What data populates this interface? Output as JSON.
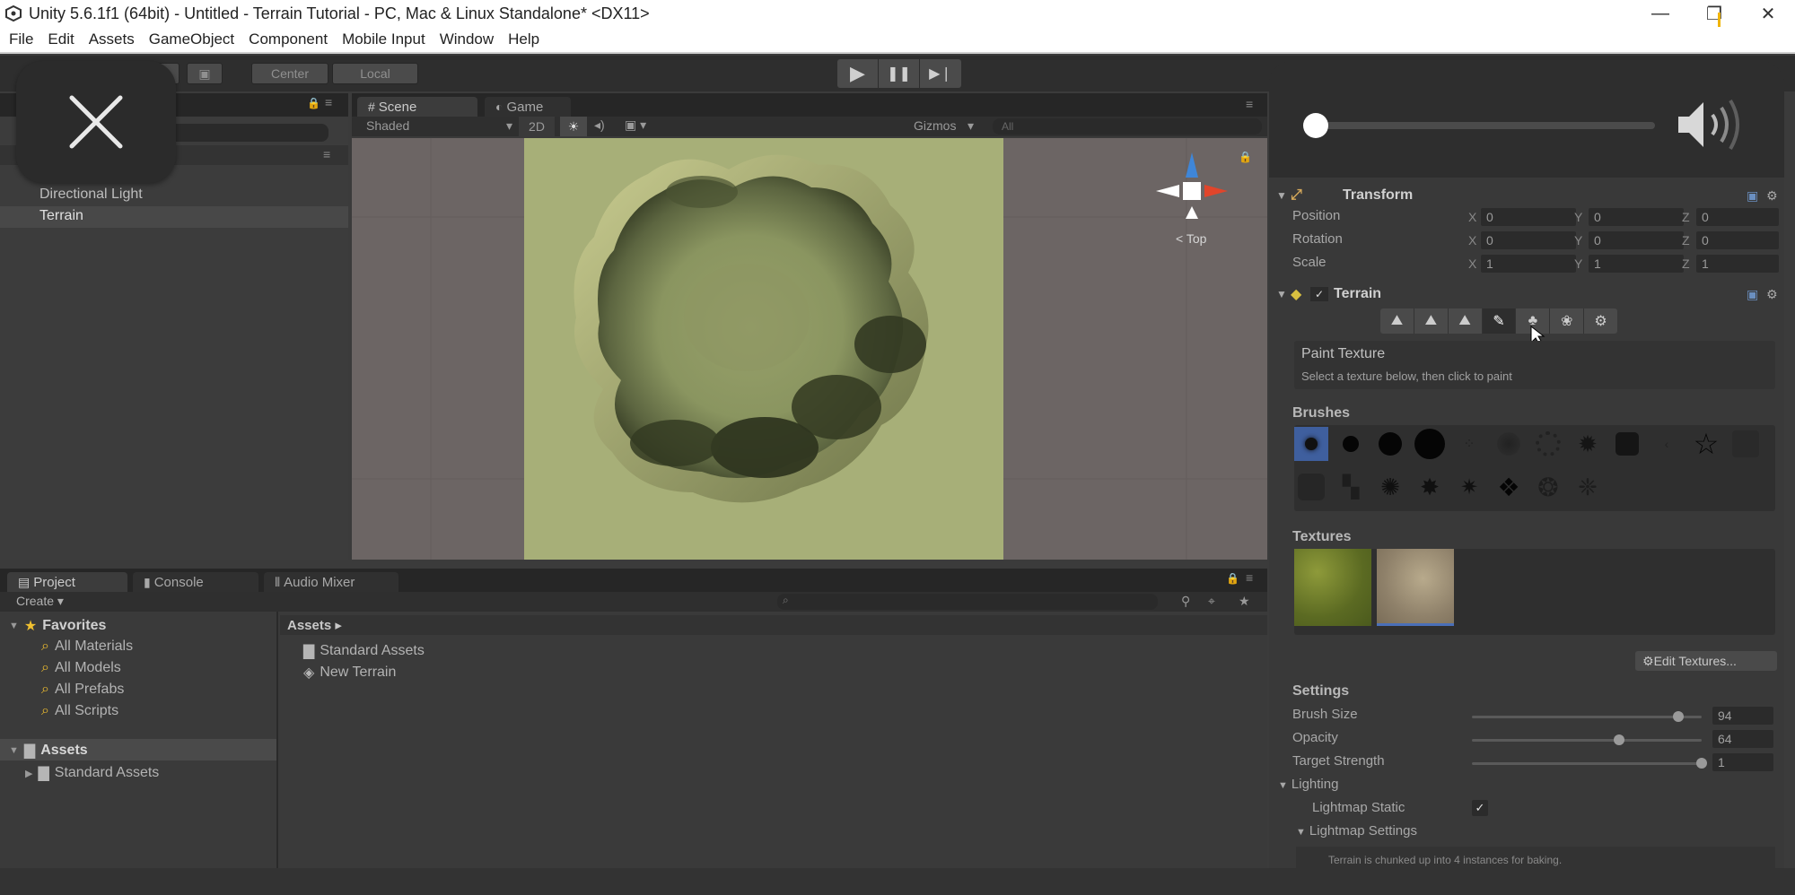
{
  "window": {
    "title": "Unity 5.6.1f1 (64bit) - Untitled - Terrain Tutorial - PC, Mac & Linux Standalone* <DX11>",
    "minimize": "—",
    "maximize": "❐",
    "close": "✕"
  },
  "menu": [
    "File",
    "Edit",
    "Assets",
    "GameObject",
    "Component",
    "Mobile Input",
    "Window",
    "Help"
  ],
  "toolbar": {
    "pivot": "Center",
    "space": "Local",
    "play": "▶",
    "pause": "❚❚",
    "step": "▶❘"
  },
  "hierarchy": {
    "items": [
      "Directional Light",
      "Terrain"
    ]
  },
  "scene": {
    "tabs": [
      "Scene",
      "Game"
    ],
    "shading": "Shaded",
    "mode_2d": "2D",
    "gizmos": "Gizmos",
    "search_placeholder": "All",
    "view_label": "< Top"
  },
  "inspector": {
    "transform": {
      "title": "Transform",
      "rows": [
        {
          "label": "Position",
          "x": "0",
          "y": "0",
          "z": "0"
        },
        {
          "label": "Rotation",
          "x": "0",
          "y": "0",
          "z": "0"
        },
        {
          "label": "Scale",
          "x": "1",
          "y": "1",
          "z": "1"
        }
      ]
    },
    "terrain": {
      "title": "Terrain",
      "tool_title": "Paint Texture",
      "tool_desc": "Select a texture below, then click to paint",
      "brushes_label": "Brushes",
      "textures_label": "Textures",
      "edit_textures": "Edit Textures...",
      "settings_label": "Settings",
      "brush_size_label": "Brush Size",
      "brush_size": "94",
      "brush_size_fraction": 0.9,
      "opacity_label": "Opacity",
      "opacity": "64",
      "opacity_fraction": 0.64,
      "target_strength_label": "Target Strength",
      "target_strength": "1",
      "target_strength_fraction": 1.0,
      "lighting_label": "Lighting",
      "lightmap_static_label": "Lightmap Static",
      "lightmap_static": true,
      "lightmap_settings_label": "Lightmap Settings",
      "bottom_note": "Terrain is chunked up into 4 instances for baking."
    }
  },
  "project": {
    "tabs": [
      "Project",
      "Console",
      "Audio Mixer"
    ],
    "create": "Create",
    "favorites_label": "Favorites",
    "favorites": [
      "All Materials",
      "All Models",
      "All Prefabs",
      "All Scripts"
    ],
    "assets_label": "Assets",
    "tree_assets": [
      "Standard Assets"
    ],
    "breadcrumb": "Assets ▸",
    "files": [
      {
        "name": "Standard Assets",
        "icon": "folder-icon"
      },
      {
        "name": "New Terrain",
        "icon": "terrain-asset-icon"
      }
    ]
  },
  "colors": {
    "terrain_green": "#a7af78",
    "terrain_dark": "#3d4429",
    "selected_brush": "#3f5f9e",
    "axis_x": "#e0452b",
    "axis_y": "#3f86d8"
  }
}
